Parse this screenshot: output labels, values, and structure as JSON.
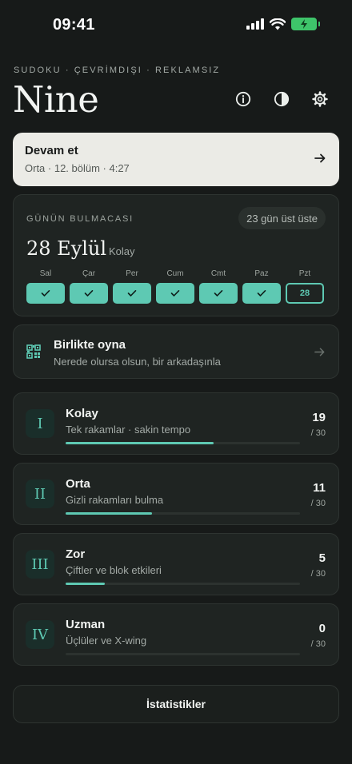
{
  "status_bar": {
    "time": "09:41"
  },
  "header": {
    "eyebrow": "SUDOKU · ÇEVRİMDIŞI · REKLAMSIZ",
    "title": "Nine"
  },
  "continue_card": {
    "title": "Devam et",
    "subtitle": "Orta · 12. bölüm · 4:27"
  },
  "daily": {
    "label": "GÜNÜN BULMACASI",
    "streak": "23 gün üst üste",
    "date": "28 Eylül",
    "difficulty": "Kolay",
    "days": [
      {
        "label": "Sal",
        "done": true
      },
      {
        "label": "Çar",
        "done": true
      },
      {
        "label": "Per",
        "done": true
      },
      {
        "label": "Cum",
        "done": true
      },
      {
        "label": "Cmt",
        "done": true
      },
      {
        "label": "Paz",
        "done": true
      },
      {
        "label": "Pzt",
        "done": false,
        "value": "28"
      }
    ]
  },
  "multiplayer": {
    "title": "Birlikte oyna",
    "subtitle": "Nerede olursa olsun, bir arkadaşınla"
  },
  "levels": [
    {
      "numeral": "I",
      "name": "Kolay",
      "desc": "Tek rakamlar · sakin tempo",
      "count": "19",
      "total": "/ 30",
      "progress": 0.633
    },
    {
      "numeral": "II",
      "name": "Orta",
      "desc": "Gizli rakamları bulma",
      "count": "11",
      "total": "/ 30",
      "progress": 0.367
    },
    {
      "numeral": "III",
      "name": "Zor",
      "desc": "Çiftler ve blok etkileri",
      "count": "5",
      "total": "/ 30",
      "progress": 0.167
    },
    {
      "numeral": "IV",
      "name": "Uzman",
      "desc": "Üçlüler ve X-wing",
      "count": "0",
      "total": "/ 30",
      "progress": 0
    }
  ],
  "stats_button": {
    "label": "İstatistikler"
  },
  "colors": {
    "background": "#171a19",
    "accent": "#5ec9b3",
    "card": "#1f2422",
    "continue_card": "#ebebe6",
    "battery": "#3ec46a"
  },
  "icons": {
    "info": "info-icon",
    "theme": "contrast-icon",
    "settings": "gear-icon",
    "continue": "arrow-right-icon",
    "multiplayer": "qr-code-icon",
    "check": "check-icon"
  }
}
